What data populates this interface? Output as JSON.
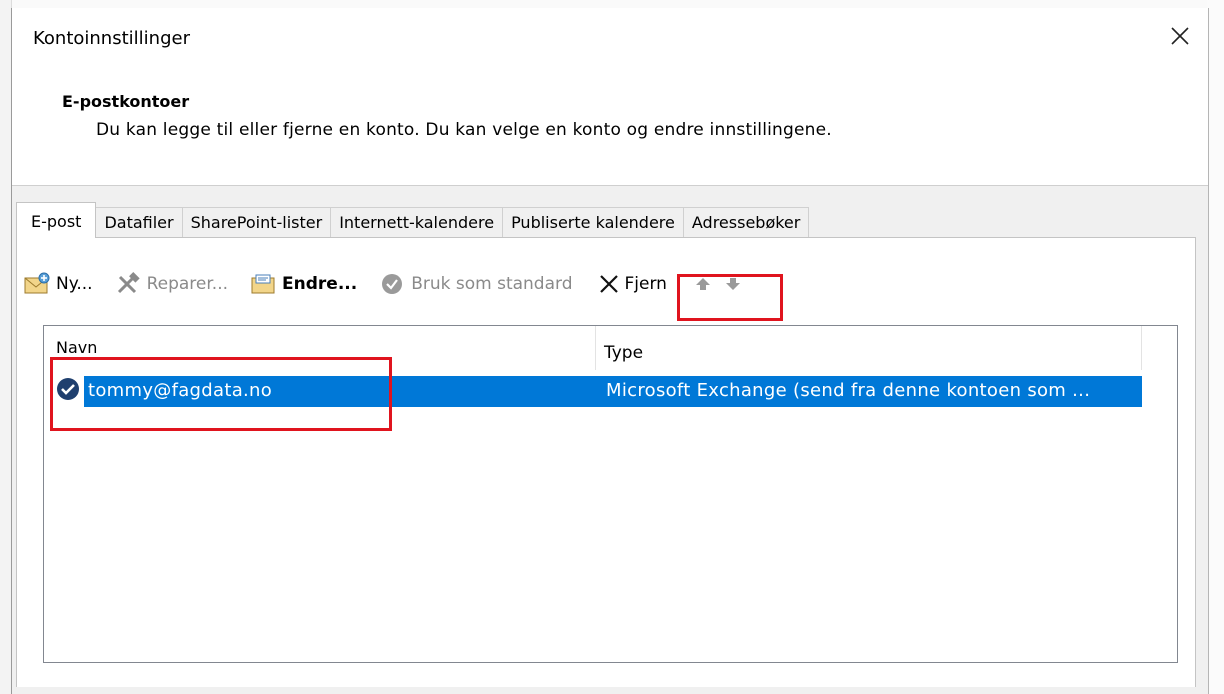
{
  "dialog": {
    "title": "Kontoinnstillinger",
    "heading": "E-postkontoer",
    "description": "Du kan legge til eller fjerne en konto. Du kan velge en konto og endre innstillingene."
  },
  "tabs": [
    {
      "label": "E-post",
      "active": true
    },
    {
      "label": "Datafiler"
    },
    {
      "label": "SharePoint-lister"
    },
    {
      "label": "Internett-kalendere"
    },
    {
      "label": "Publiserte kalendere"
    },
    {
      "label": "Adressebøker"
    }
  ],
  "toolbar": {
    "new_label": "Ny...",
    "repair_label": "Reparer...",
    "change_label": "Endre...",
    "default_label": "Bruk som standard",
    "remove_label": "Fjern"
  },
  "list": {
    "columns": {
      "name": "Navn",
      "type": "Type"
    },
    "rows": [
      {
        "name": "tommy@fagdata.no",
        "type": "Microsoft Exchange (send fra denne kontoen som ..."
      }
    ]
  },
  "colors": {
    "selection": "#0078d7",
    "highlight": "#e0141e"
  }
}
